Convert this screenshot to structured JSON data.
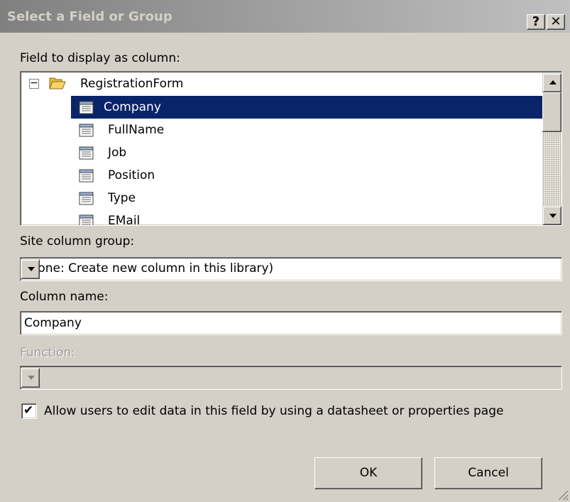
{
  "window": {
    "title": "Select a Field or Group",
    "help_label": "?",
    "close_label": "✕"
  },
  "tree": {
    "label": "Field to display as column:",
    "root_label": "RegistrationForm",
    "root_expander": "−",
    "items": [
      "Company",
      "FullName",
      "Job",
      "Position",
      "Type",
      "EMail"
    ],
    "selected": "Company"
  },
  "site_column_group": {
    "label": "Site column group:",
    "value": "(None: Create new column in this library)"
  },
  "column_name": {
    "label": "Column name:",
    "value": "Company"
  },
  "function": {
    "label": "Function:",
    "value": "",
    "enabled": false
  },
  "allow_edit": {
    "label": "Allow users to edit data in this field by using a datasheet or properties page",
    "checked": true,
    "check_glyph": "✔"
  },
  "buttons": {
    "ok": "OK",
    "cancel": "Cancel"
  },
  "colors": {
    "face": "#d4d0c8",
    "selection": "#0a246a",
    "title_start": "#808080",
    "title_end": "#c0c0c0"
  }
}
